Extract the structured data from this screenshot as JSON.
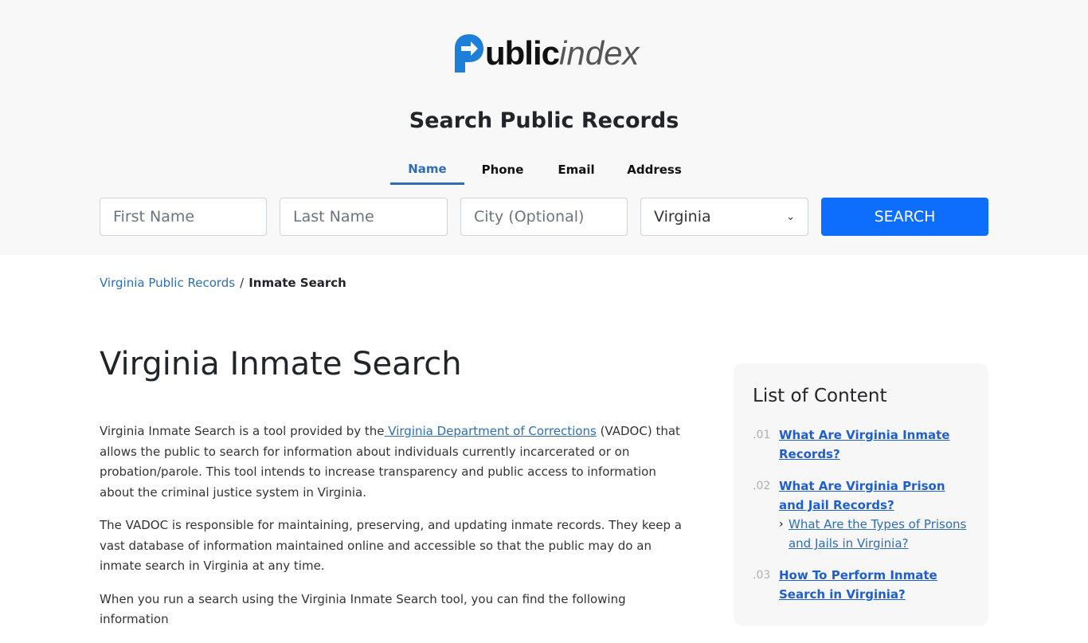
{
  "brand": {
    "logo_bold": "ublic",
    "logo_light": "index",
    "accent_color": "#1e7fd8"
  },
  "search": {
    "title": "Search Public Records",
    "tabs": [
      {
        "label": "Name",
        "active": true
      },
      {
        "label": "Phone",
        "active": false
      },
      {
        "label": "Email",
        "active": false
      },
      {
        "label": "Address",
        "active": false
      }
    ],
    "first_name_placeholder": "First Name",
    "last_name_placeholder": "Last Name",
    "city_placeholder": "City (Optional)",
    "state_selected": "Virginia",
    "button_label": "SEARCH",
    "button_color": "#0d6efd"
  },
  "breadcrumb": {
    "parent": "Virginia Public Records",
    "separator": "/",
    "current": "Inmate Search"
  },
  "article": {
    "title": "Virginia Inmate Search",
    "p1_before": "Virginia Inmate Search is a tool provided by the",
    "p1_link": " Virginia Department of Corrections",
    "p1_after": " (VADOC) that allows the public to search for information about individuals currently incarcerated or on probation/parole. This tool intends to increase transparency and public access to information about the criminal justice system in Virginia.",
    "p2": "The VADOC is responsible for maintaining, preserving, and updating inmate records. They keep a vast database of information maintained online and accessible so that the public may do an inmate search in Virginia at any time.",
    "p3": "When you run a search using the Virginia Inmate Search tool, you can find the following information"
  },
  "toc": {
    "title": "List of Content",
    "items": [
      {
        "num": ".01",
        "label": "What Are Virginia Inmate Records?"
      },
      {
        "num": ".02",
        "label": "What Are Virginia Prison and Jail Records?",
        "sub": "What Are the Types of Prisons and Jails in Virginia?"
      },
      {
        "num": ".03",
        "label": "How To Perform Inmate Search in Virginia? "
      }
    ]
  }
}
